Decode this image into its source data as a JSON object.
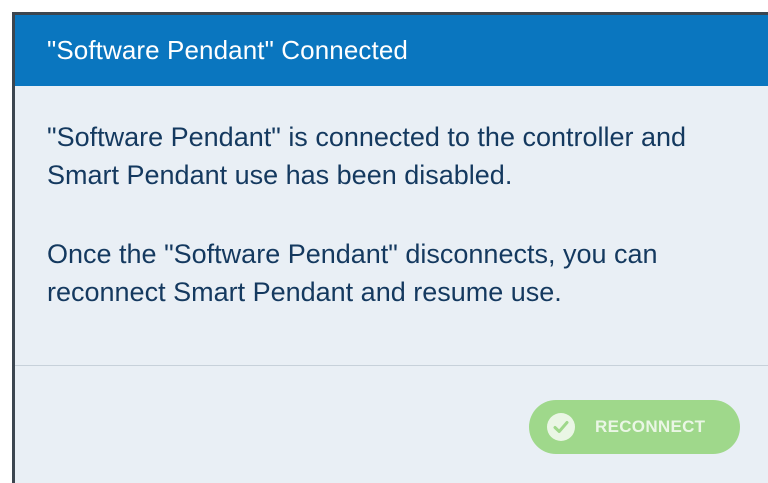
{
  "dialog": {
    "title": "\"Software Pendant\" Connected",
    "message_1": "\"Software Pendant\" is connected to the controller and Smart Pendant use has been disabled.",
    "message_2": "Once the \"Software Pendant\" disconnects, you can reconnect Smart Pendant and resume use.",
    "reconnect_button": {
      "label": "RECONNECT",
      "icon": "check-circle-icon",
      "state": "disabled"
    }
  },
  "colors": {
    "header": "#0a76bf",
    "body_background": "#e9eff5",
    "text": "#14395f",
    "button": "#9fd88b"
  }
}
